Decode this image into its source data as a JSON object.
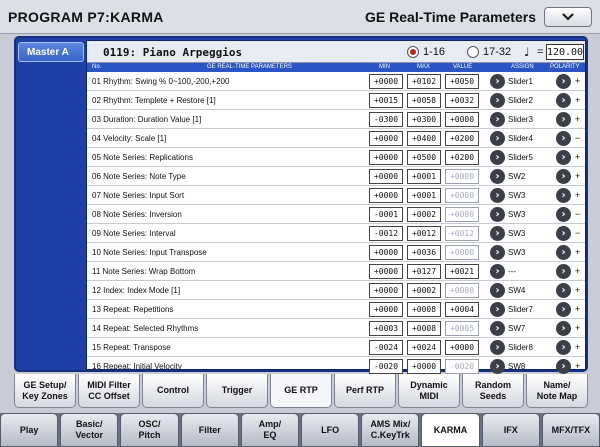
{
  "title": {
    "left": "PROGRAM P7:KARMA",
    "right": "GE Real-Time Parameters"
  },
  "master_tab": "Master A",
  "program": {
    "name": "0119: Piano Arpeggios",
    "radio1": "1-16",
    "radio2": "17-32",
    "tempo_symbol": "♩",
    "tempo_eq": "=",
    "tempo": "120.00"
  },
  "headers": {
    "no": "No.",
    "params": "GE REAL-TIME PARAMETERS",
    "min": "MIN",
    "max": "MAX",
    "value": "VALUE",
    "assign": "ASSIGN",
    "polarity": "POLARITY"
  },
  "rows": [
    {
      "name": "01 Rhythm: Swing % 0~100,-200,+200",
      "min": "+0000",
      "max": "+0102",
      "value": "+0050",
      "value_dim": false,
      "assign": "Slider1",
      "polarity": "+"
    },
    {
      "name": "02 Rhythm: Templete + Restore [1]",
      "min": "+0015",
      "max": "+0058",
      "value": "+0032",
      "value_dim": false,
      "assign": "Slider2",
      "polarity": "+"
    },
    {
      "name": "03 Duration: Duration Value [1]",
      "min": "-0300",
      "max": "+0300",
      "value": "+0000",
      "value_dim": false,
      "assign": "Slider3",
      "polarity": "+"
    },
    {
      "name": "04 Velocity: Scale [1]",
      "min": "+0000",
      "max": "+0400",
      "value": "+0200",
      "value_dim": false,
      "assign": "Slider4",
      "polarity": "−"
    },
    {
      "name": "05 Note Series: Replications",
      "min": "+0000",
      "max": "+0500",
      "value": "+0200",
      "value_dim": false,
      "assign": "Slider5",
      "polarity": "+"
    },
    {
      "name": "06 Note Series: Note Type",
      "min": "+0000",
      "max": "+0001",
      "value": "+0000",
      "value_dim": true,
      "assign": "SW2",
      "polarity": "+"
    },
    {
      "name": "07 Note Series: Input Sort",
      "min": "+0000",
      "max": "+0001",
      "value": "+0000",
      "value_dim": true,
      "assign": "SW3",
      "polarity": "+"
    },
    {
      "name": "08 Note Series: Inversion",
      "min": "-0001",
      "max": "+0002",
      "value": "+0000",
      "value_dim": true,
      "assign": "SW3",
      "polarity": "−"
    },
    {
      "name": "09 Note Series: Interval",
      "min": "-0012",
      "max": "+0012",
      "value": "+0012",
      "value_dim": true,
      "assign": "SW3",
      "polarity": "−"
    },
    {
      "name": "10 Note Series: Input Transpose",
      "min": "+0000",
      "max": "+0036",
      "value": "+0000",
      "value_dim": true,
      "assign": "SW3",
      "polarity": "+"
    },
    {
      "name": "11 Note Series: Wrap Bottom",
      "min": "+0000",
      "max": "+0127",
      "value": "+0021",
      "value_dim": false,
      "assign": "---",
      "polarity": "+"
    },
    {
      "name": "12 Index: Index Mode [1]",
      "min": "+0000",
      "max": "+0002",
      "value": "+0000",
      "value_dim": true,
      "assign": "SW4",
      "polarity": "+"
    },
    {
      "name": "13 Repeat: Repetitions",
      "min": "+0000",
      "max": "+0008",
      "value": "+0004",
      "value_dim": false,
      "assign": "Slider7",
      "polarity": "+"
    },
    {
      "name": "14 Repeat: Selected Rhythms",
      "min": "+0003",
      "max": "+0008",
      "value": "+0005",
      "value_dim": true,
      "assign": "SW7",
      "polarity": "+"
    },
    {
      "name": "15 Repeat: Transpose",
      "min": "-0024",
      "max": "+0024",
      "value": "+0000",
      "value_dim": false,
      "assign": "Slider8",
      "polarity": "+"
    },
    {
      "name": "16 Repeat: Initial Velocity",
      "min": "-0020",
      "max": "+0000",
      "value": "-0020",
      "value_dim": true,
      "assign": "SW8",
      "polarity": "+"
    }
  ],
  "sub_tabs": [
    {
      "label": "GE Setup/\nKey Zones"
    },
    {
      "label": "MIDI Filter\nCC Offset"
    },
    {
      "label": "Control"
    },
    {
      "label": "Trigger"
    },
    {
      "label": "GE RTP",
      "active": true
    },
    {
      "label": "Perf RTP"
    },
    {
      "label": "Dynamic\nMIDI"
    },
    {
      "label": "Random\nSeeds"
    },
    {
      "label": "Name/\nNote Map"
    }
  ],
  "page_tabs": [
    {
      "label": "Play"
    },
    {
      "label": "Basic/\nVector"
    },
    {
      "label": "OSC/\nPitch"
    },
    {
      "label": "Filter"
    },
    {
      "label": "Amp/\nEQ"
    },
    {
      "label": "LFO"
    },
    {
      "label": "AMS Mix/\nC.KeyTrk"
    },
    {
      "label": "KARMA",
      "active": true
    },
    {
      "label": "IFX"
    },
    {
      "label": "MFX/TFX"
    }
  ]
}
